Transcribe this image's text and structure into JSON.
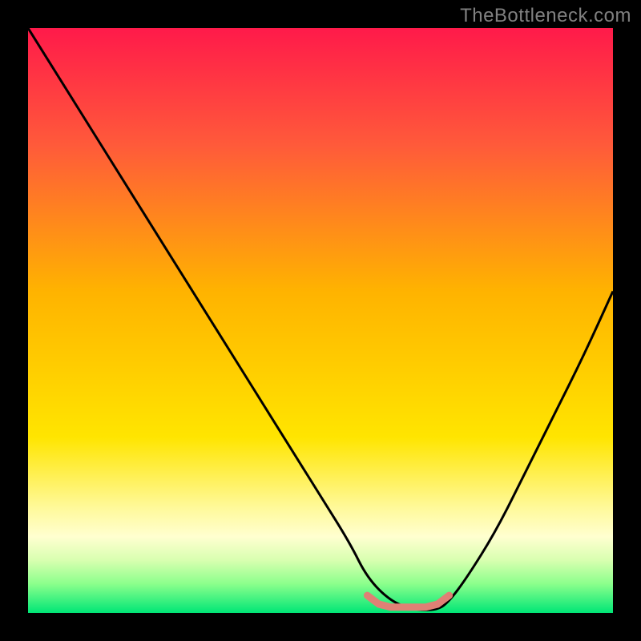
{
  "watermark": "TheBottleneck.com",
  "chart_data": {
    "type": "line",
    "title": "",
    "xlabel": "",
    "ylabel": "",
    "xlim": [
      0,
      100
    ],
    "ylim": [
      0,
      100
    ],
    "gradient_stops": [
      {
        "offset": 0,
        "color": "#ff1a4a"
      },
      {
        "offset": 20,
        "color": "#ff5a3a"
      },
      {
        "offset": 45,
        "color": "#ffb300"
      },
      {
        "offset": 70,
        "color": "#ffe500"
      },
      {
        "offset": 82,
        "color": "#fff99a"
      },
      {
        "offset": 87,
        "color": "#ffffd0"
      },
      {
        "offset": 91,
        "color": "#d8ffb0"
      },
      {
        "offset": 95,
        "color": "#8cff8c"
      },
      {
        "offset": 100,
        "color": "#00e676"
      }
    ],
    "series": [
      {
        "name": "bottleneck-curve",
        "color": "#000000",
        "x": [
          0,
          5,
          10,
          15,
          20,
          25,
          30,
          35,
          40,
          45,
          50,
          55,
          58,
          62,
          66,
          70,
          72,
          75,
          80,
          85,
          90,
          95,
          100
        ],
        "y": [
          100,
          92,
          84,
          76,
          68,
          60,
          52,
          44,
          36,
          28,
          20,
          12,
          6,
          2,
          0.5,
          0.5,
          2,
          6,
          14,
          24,
          34,
          44,
          55
        ]
      },
      {
        "name": "optimal-marker",
        "color": "#e08075",
        "x": [
          58,
          60,
          62,
          64,
          66,
          68,
          70,
          72
        ],
        "y": [
          3.0,
          1.5,
          1.0,
          1.0,
          1.0,
          1.0,
          1.5,
          3.0
        ]
      }
    ]
  }
}
